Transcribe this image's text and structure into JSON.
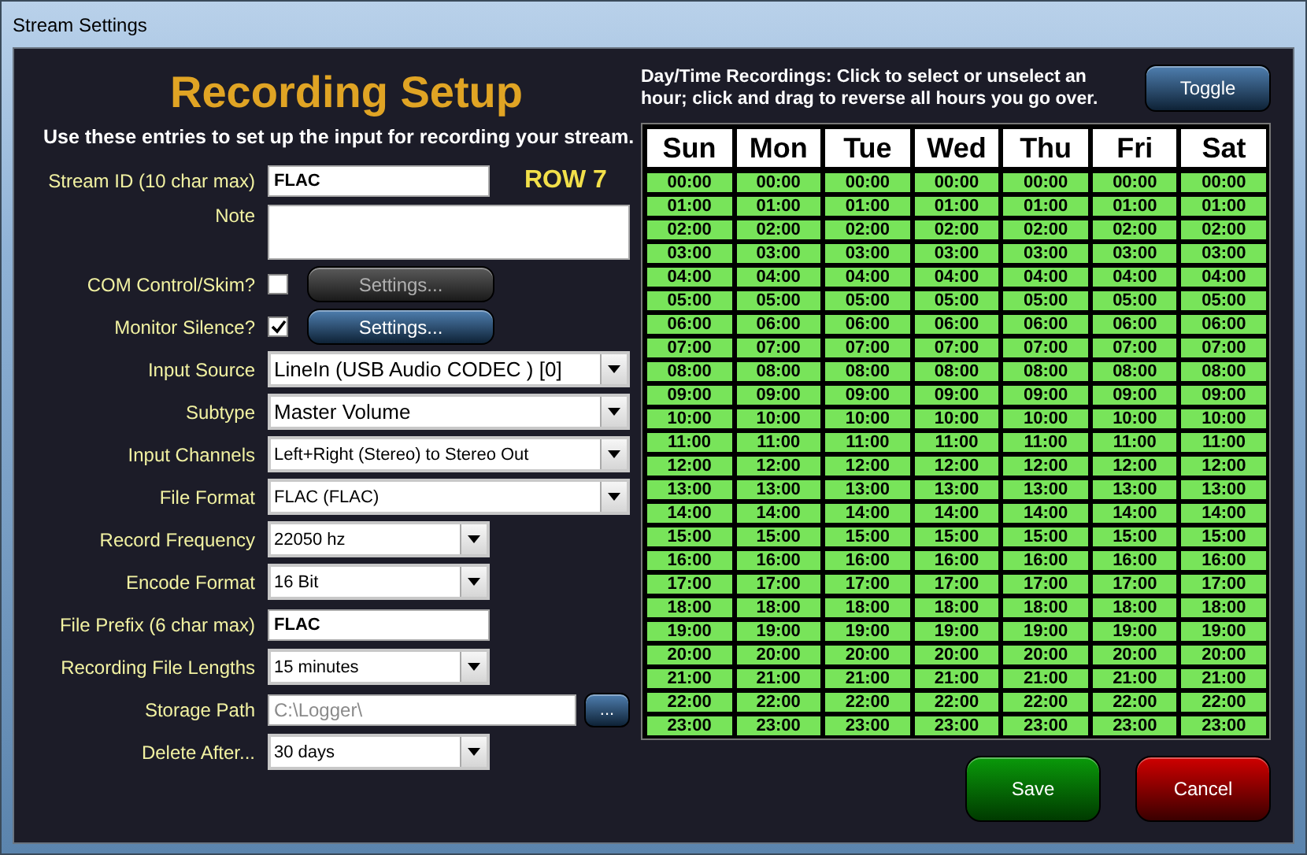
{
  "window": {
    "title": "Stream Settings"
  },
  "setup": {
    "title": "Recording Setup",
    "subtitle": "Use these entries to set up the input for recording your stream.",
    "row_label": "ROW 7",
    "fields": [
      {
        "kind": "text",
        "label": "Stream ID (10 char max)",
        "value": "FLAC"
      },
      {
        "kind": "textarea",
        "label": "Note"
      },
      {
        "kind": "checkbox",
        "label": "COM Control/Skim?",
        "checked": false,
        "button": {
          "label": "Settings...",
          "disabled": true
        }
      },
      {
        "kind": "checkbox",
        "label": "Monitor Silence?",
        "checked": true,
        "button": {
          "label": "Settings...",
          "disabled": false
        }
      },
      {
        "kind": "select",
        "label": "Input Source",
        "value": "LineIn (USB Audio CODEC ) [0]"
      },
      {
        "kind": "select",
        "label": "Subtype",
        "value": "Master Volume"
      },
      {
        "kind": "select-small",
        "label": "Input Channels",
        "value": "Left+Right (Stereo) to Stereo Out"
      },
      {
        "kind": "select-small",
        "label": "File Format",
        "value": "FLAC (FLAC)"
      },
      {
        "kind": "short-select",
        "label": "Record Frequency",
        "value": "22050 hz"
      },
      {
        "kind": "short-select",
        "label": "Encode Format",
        "value": "16 Bit"
      },
      {
        "kind": "short-text",
        "label": "File Prefix (6 char max)",
        "value": "FLAC"
      },
      {
        "kind": "short-select",
        "label": "Recording File Lengths",
        "value": "15 minutes"
      },
      {
        "kind": "path",
        "label": "Storage Path",
        "value": "C:\\Logger\\",
        "disabled": true,
        "button": {
          "label": "..."
        }
      },
      {
        "kind": "short-select",
        "label": "Delete After...",
        "value": "30 days"
      }
    ]
  },
  "schedule": {
    "instructions": "Day/Time Recordings: Click to select or unselect an hour; click and drag to reverse all hours you go over.",
    "toggle": "Toggle",
    "days": [
      {
        "label": "Sun",
        "hours": [
          {
            "label": "00:00",
            "selected": true
          },
          {
            "label": "01:00",
            "selected": true
          },
          {
            "label": "02:00",
            "selected": true
          },
          {
            "label": "03:00",
            "selected": true
          },
          {
            "label": "04:00",
            "selected": true
          },
          {
            "label": "05:00",
            "selected": true
          },
          {
            "label": "06:00",
            "selected": true
          },
          {
            "label": "07:00",
            "selected": true
          },
          {
            "label": "08:00",
            "selected": true
          },
          {
            "label": "09:00",
            "selected": true
          },
          {
            "label": "10:00",
            "selected": true
          },
          {
            "label": "11:00",
            "selected": true
          },
          {
            "label": "12:00",
            "selected": true
          },
          {
            "label": "13:00",
            "selected": true
          },
          {
            "label": "14:00",
            "selected": true
          },
          {
            "label": "15:00",
            "selected": true
          },
          {
            "label": "16:00",
            "selected": true
          },
          {
            "label": "17:00",
            "selected": true
          },
          {
            "label": "18:00",
            "selected": true
          },
          {
            "label": "19:00",
            "selected": true
          },
          {
            "label": "20:00",
            "selected": true
          },
          {
            "label": "21:00",
            "selected": true
          },
          {
            "label": "22:00",
            "selected": true
          },
          {
            "label": "23:00",
            "selected": true
          }
        ]
      },
      {
        "label": "Mon",
        "hours": [
          {
            "label": "00:00",
            "selected": true
          },
          {
            "label": "01:00",
            "selected": true
          },
          {
            "label": "02:00",
            "selected": true
          },
          {
            "label": "03:00",
            "selected": true
          },
          {
            "label": "04:00",
            "selected": true
          },
          {
            "label": "05:00",
            "selected": true
          },
          {
            "label": "06:00",
            "selected": true
          },
          {
            "label": "07:00",
            "selected": true
          },
          {
            "label": "08:00",
            "selected": true
          },
          {
            "label": "09:00",
            "selected": true
          },
          {
            "label": "10:00",
            "selected": true
          },
          {
            "label": "11:00",
            "selected": true
          },
          {
            "label": "12:00",
            "selected": true
          },
          {
            "label": "13:00",
            "selected": true
          },
          {
            "label": "14:00",
            "selected": true
          },
          {
            "label": "15:00",
            "selected": true
          },
          {
            "label": "16:00",
            "selected": true
          },
          {
            "label": "17:00",
            "selected": true
          },
          {
            "label": "18:00",
            "selected": true
          },
          {
            "label": "19:00",
            "selected": true
          },
          {
            "label": "20:00",
            "selected": true
          },
          {
            "label": "21:00",
            "selected": true
          },
          {
            "label": "22:00",
            "selected": true
          },
          {
            "label": "23:00",
            "selected": true
          }
        ]
      },
      {
        "label": "Tue",
        "hours": [
          {
            "label": "00:00",
            "selected": true
          },
          {
            "label": "01:00",
            "selected": true
          },
          {
            "label": "02:00",
            "selected": true
          },
          {
            "label": "03:00",
            "selected": true
          },
          {
            "label": "04:00",
            "selected": true
          },
          {
            "label": "05:00",
            "selected": true
          },
          {
            "label": "06:00",
            "selected": true
          },
          {
            "label": "07:00",
            "selected": true
          },
          {
            "label": "08:00",
            "selected": true
          },
          {
            "label": "09:00",
            "selected": true
          },
          {
            "label": "10:00",
            "selected": true
          },
          {
            "label": "11:00",
            "selected": true
          },
          {
            "label": "12:00",
            "selected": true
          },
          {
            "label": "13:00",
            "selected": true
          },
          {
            "label": "14:00",
            "selected": true
          },
          {
            "label": "15:00",
            "selected": true
          },
          {
            "label": "16:00",
            "selected": true
          },
          {
            "label": "17:00",
            "selected": true
          },
          {
            "label": "18:00",
            "selected": true
          },
          {
            "label": "19:00",
            "selected": true
          },
          {
            "label": "20:00",
            "selected": true
          },
          {
            "label": "21:00",
            "selected": true
          },
          {
            "label": "22:00",
            "selected": true
          },
          {
            "label": "23:00",
            "selected": true
          }
        ]
      },
      {
        "label": "Wed",
        "hours": [
          {
            "label": "00:00",
            "selected": true
          },
          {
            "label": "01:00",
            "selected": true
          },
          {
            "label": "02:00",
            "selected": true
          },
          {
            "label": "03:00",
            "selected": true
          },
          {
            "label": "04:00",
            "selected": true
          },
          {
            "label": "05:00",
            "selected": true
          },
          {
            "label": "06:00",
            "selected": true
          },
          {
            "label": "07:00",
            "selected": true
          },
          {
            "label": "08:00",
            "selected": true
          },
          {
            "label": "09:00",
            "selected": true
          },
          {
            "label": "10:00",
            "selected": true
          },
          {
            "label": "11:00",
            "selected": true
          },
          {
            "label": "12:00",
            "selected": true
          },
          {
            "label": "13:00",
            "selected": true
          },
          {
            "label": "14:00",
            "selected": true
          },
          {
            "label": "15:00",
            "selected": true
          },
          {
            "label": "16:00",
            "selected": true
          },
          {
            "label": "17:00",
            "selected": true
          },
          {
            "label": "18:00",
            "selected": true
          },
          {
            "label": "19:00",
            "selected": true
          },
          {
            "label": "20:00",
            "selected": true
          },
          {
            "label": "21:00",
            "selected": true
          },
          {
            "label": "22:00",
            "selected": true
          },
          {
            "label": "23:00",
            "selected": true
          }
        ]
      },
      {
        "label": "Thu",
        "hours": [
          {
            "label": "00:00",
            "selected": true
          },
          {
            "label": "01:00",
            "selected": true
          },
          {
            "label": "02:00",
            "selected": true
          },
          {
            "label": "03:00",
            "selected": true
          },
          {
            "label": "04:00",
            "selected": true
          },
          {
            "label": "05:00",
            "selected": true
          },
          {
            "label": "06:00",
            "selected": true
          },
          {
            "label": "07:00",
            "selected": true
          },
          {
            "label": "08:00",
            "selected": true
          },
          {
            "label": "09:00",
            "selected": true
          },
          {
            "label": "10:00",
            "selected": true
          },
          {
            "label": "11:00",
            "selected": true
          },
          {
            "label": "12:00",
            "selected": true
          },
          {
            "label": "13:00",
            "selected": true
          },
          {
            "label": "14:00",
            "selected": true
          },
          {
            "label": "15:00",
            "selected": true
          },
          {
            "label": "16:00",
            "selected": true
          },
          {
            "label": "17:00",
            "selected": true
          },
          {
            "label": "18:00",
            "selected": true
          },
          {
            "label": "19:00",
            "selected": true
          },
          {
            "label": "20:00",
            "selected": true
          },
          {
            "label": "21:00",
            "selected": true
          },
          {
            "label": "22:00",
            "selected": true
          },
          {
            "label": "23:00",
            "selected": true
          }
        ]
      },
      {
        "label": "Fri",
        "hours": [
          {
            "label": "00:00",
            "selected": true
          },
          {
            "label": "01:00",
            "selected": true
          },
          {
            "label": "02:00",
            "selected": true
          },
          {
            "label": "03:00",
            "selected": true
          },
          {
            "label": "04:00",
            "selected": true
          },
          {
            "label": "05:00",
            "selected": true
          },
          {
            "label": "06:00",
            "selected": true
          },
          {
            "label": "07:00",
            "selected": true
          },
          {
            "label": "08:00",
            "selected": true
          },
          {
            "label": "09:00",
            "selected": true
          },
          {
            "label": "10:00",
            "selected": true
          },
          {
            "label": "11:00",
            "selected": true
          },
          {
            "label": "12:00",
            "selected": true
          },
          {
            "label": "13:00",
            "selected": true
          },
          {
            "label": "14:00",
            "selected": true
          },
          {
            "label": "15:00",
            "selected": true
          },
          {
            "label": "16:00",
            "selected": true
          },
          {
            "label": "17:00",
            "selected": true
          },
          {
            "label": "18:00",
            "selected": true
          },
          {
            "label": "19:00",
            "selected": true
          },
          {
            "label": "20:00",
            "selected": true
          },
          {
            "label": "21:00",
            "selected": true
          },
          {
            "label": "22:00",
            "selected": true
          },
          {
            "label": "23:00",
            "selected": true
          }
        ]
      },
      {
        "label": "Sat",
        "hours": [
          {
            "label": "00:00",
            "selected": true
          },
          {
            "label": "01:00",
            "selected": true
          },
          {
            "label": "02:00",
            "selected": true
          },
          {
            "label": "03:00",
            "selected": true
          },
          {
            "label": "04:00",
            "selected": true
          },
          {
            "label": "05:00",
            "selected": true
          },
          {
            "label": "06:00",
            "selected": true
          },
          {
            "label": "07:00",
            "selected": true
          },
          {
            "label": "08:00",
            "selected": true
          },
          {
            "label": "09:00",
            "selected": true
          },
          {
            "label": "10:00",
            "selected": true
          },
          {
            "label": "11:00",
            "selected": true
          },
          {
            "label": "12:00",
            "selected": true
          },
          {
            "label": "13:00",
            "selected": true
          },
          {
            "label": "14:00",
            "selected": true
          },
          {
            "label": "15:00",
            "selected": true
          },
          {
            "label": "16:00",
            "selected": true
          },
          {
            "label": "17:00",
            "selected": true
          },
          {
            "label": "18:00",
            "selected": true
          },
          {
            "label": "19:00",
            "selected": true
          },
          {
            "label": "20:00",
            "selected": true
          },
          {
            "label": "21:00",
            "selected": true
          },
          {
            "label": "22:00",
            "selected": true
          },
          {
            "label": "23:00",
            "selected": true
          }
        ]
      }
    ]
  },
  "buttons": [
    {
      "kind": "save",
      "label": "Save"
    },
    {
      "kind": "cancel",
      "label": "Cancel"
    }
  ]
}
